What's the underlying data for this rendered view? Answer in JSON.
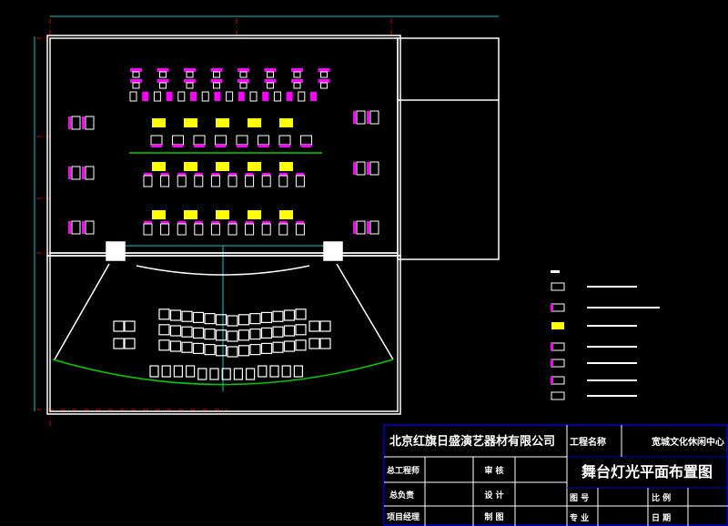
{
  "colors": {
    "background": "#000000",
    "wall": "#ffffff",
    "fixture_magenta": "#ff00ff",
    "fixture_yellow": "#ffff00",
    "curtain_line": "#00cc00",
    "dimension_line": "#00cccc",
    "axis_line": "#cc0000",
    "title_block_border": "#0000cc"
  },
  "title_block": {
    "company": "北京红旗日盛演艺器材有限公司",
    "project_label": "工程名称",
    "project_name": "宽城文化休闲中心",
    "drawing_title": "舞台灯光平面布置图",
    "labels": {
      "chief_engineer": "总工程师",
      "review": "审 核",
      "chief_responsible": "总负责",
      "design": "设 计",
      "project_manager": "项目经理",
      "drafting": "制 图",
      "drawing_no": "图 号",
      "scale": "比 例",
      "discipline": "专 业",
      "date": "日 期"
    }
  }
}
